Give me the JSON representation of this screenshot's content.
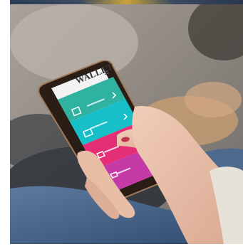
{
  "scene": {
    "background_color": "#9a9590",
    "rock_color": "#2a2f36",
    "leaf_color": "#c89d72",
    "denim_color": "#4d6a8c"
  },
  "app": {
    "title": "WALLET",
    "accent_colors": [
      "#2fb2a0",
      "#1ec1c8",
      "#e42e76",
      "#c23aa8"
    ],
    "menu_items": [
      {
        "label": "",
        "icon": "id-card-icon",
        "color": "#2fb2a0"
      },
      {
        "label": "",
        "icon": "card-icon",
        "color": "#17c0c8"
      },
      {
        "label": "",
        "icon": "tag-icon",
        "color": "#e42e76"
      },
      {
        "label": "",
        "icon": "shopping-cart-icon",
        "color": "#c53aa7"
      }
    ]
  }
}
